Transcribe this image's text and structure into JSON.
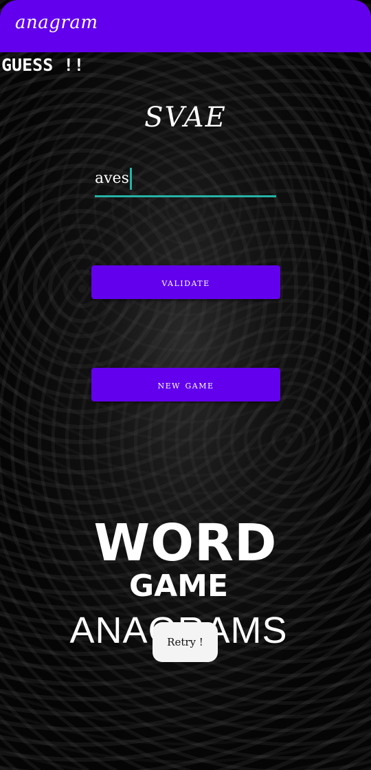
{
  "app_bar": {
    "title": "anagram",
    "color": "#6200ee"
  },
  "game": {
    "guess_label": "GUESS !!",
    "scrambled_word": "SVAE",
    "answer_value": "aves",
    "validate_label": "VALIDATE",
    "new_game_label": "NEW GAME"
  },
  "logo": {
    "line1": "WORD",
    "line2": "GAME",
    "line3": "ANAGRAMS"
  },
  "toast": {
    "retry_label": "Retry !"
  },
  "colors": {
    "accent": "#6200ee",
    "input_underline": "#26b3a6",
    "background": "#050505"
  }
}
